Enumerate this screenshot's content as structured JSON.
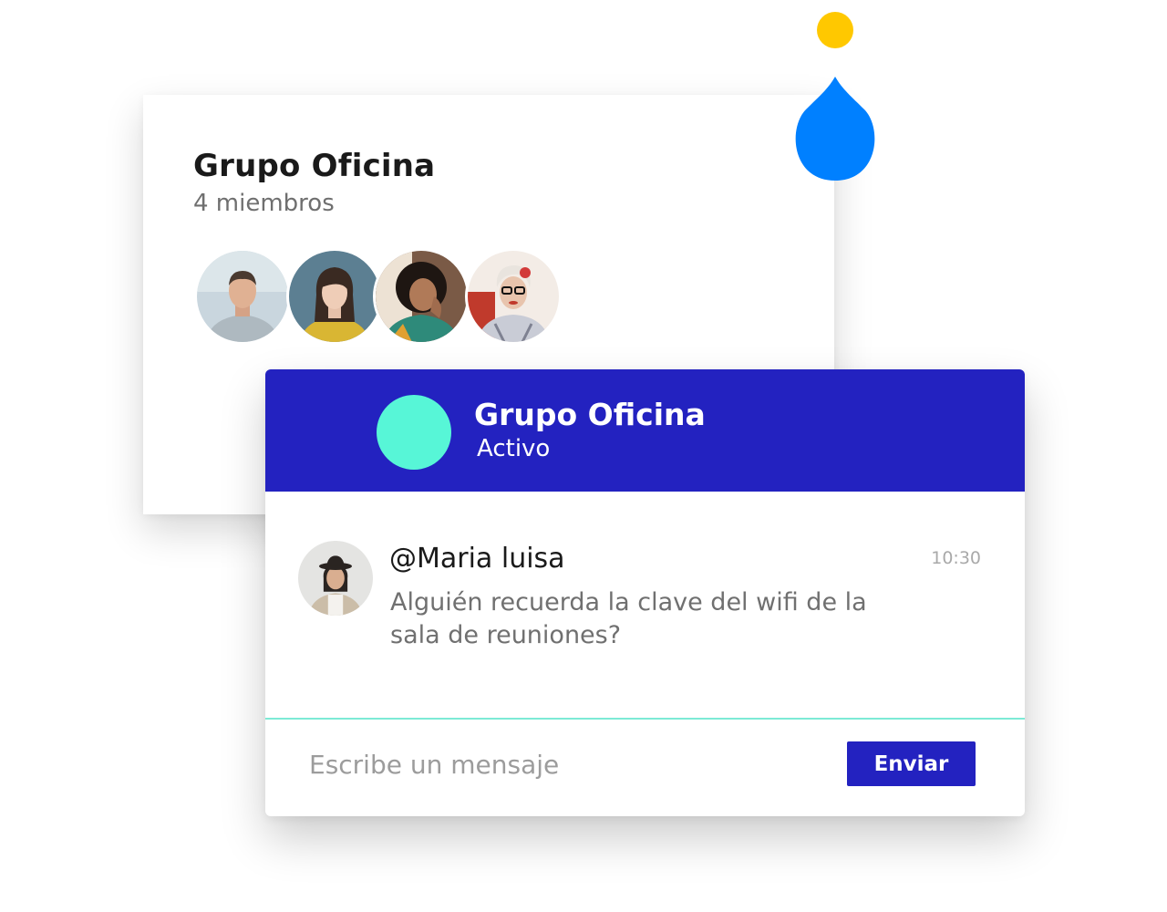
{
  "group_card": {
    "title": "Grupo Oficina",
    "members_label": "4 miembros",
    "member_avatars": [
      "man-portrait",
      "woman-yellow-shirt-portrait",
      "woman-curly-hair-portrait",
      "elderly-woman-glasses-portrait"
    ]
  },
  "chat": {
    "header": {
      "title": "Grupo Oficina",
      "status": "Activo"
    },
    "message": {
      "author": "@Maria luisa",
      "time": "10:30",
      "text": "Alguién recuerda la clave del wifi de la sala de reuniones?"
    },
    "composer": {
      "placeholder": "Escribe un mensaje",
      "send_label": "Enviar"
    }
  },
  "colors": {
    "header_bg": "#2322C0",
    "header_avatar": "#57F6D7",
    "divider": "#7DEAD6",
    "drop": "#0080FF",
    "dot": "#FFC800"
  }
}
